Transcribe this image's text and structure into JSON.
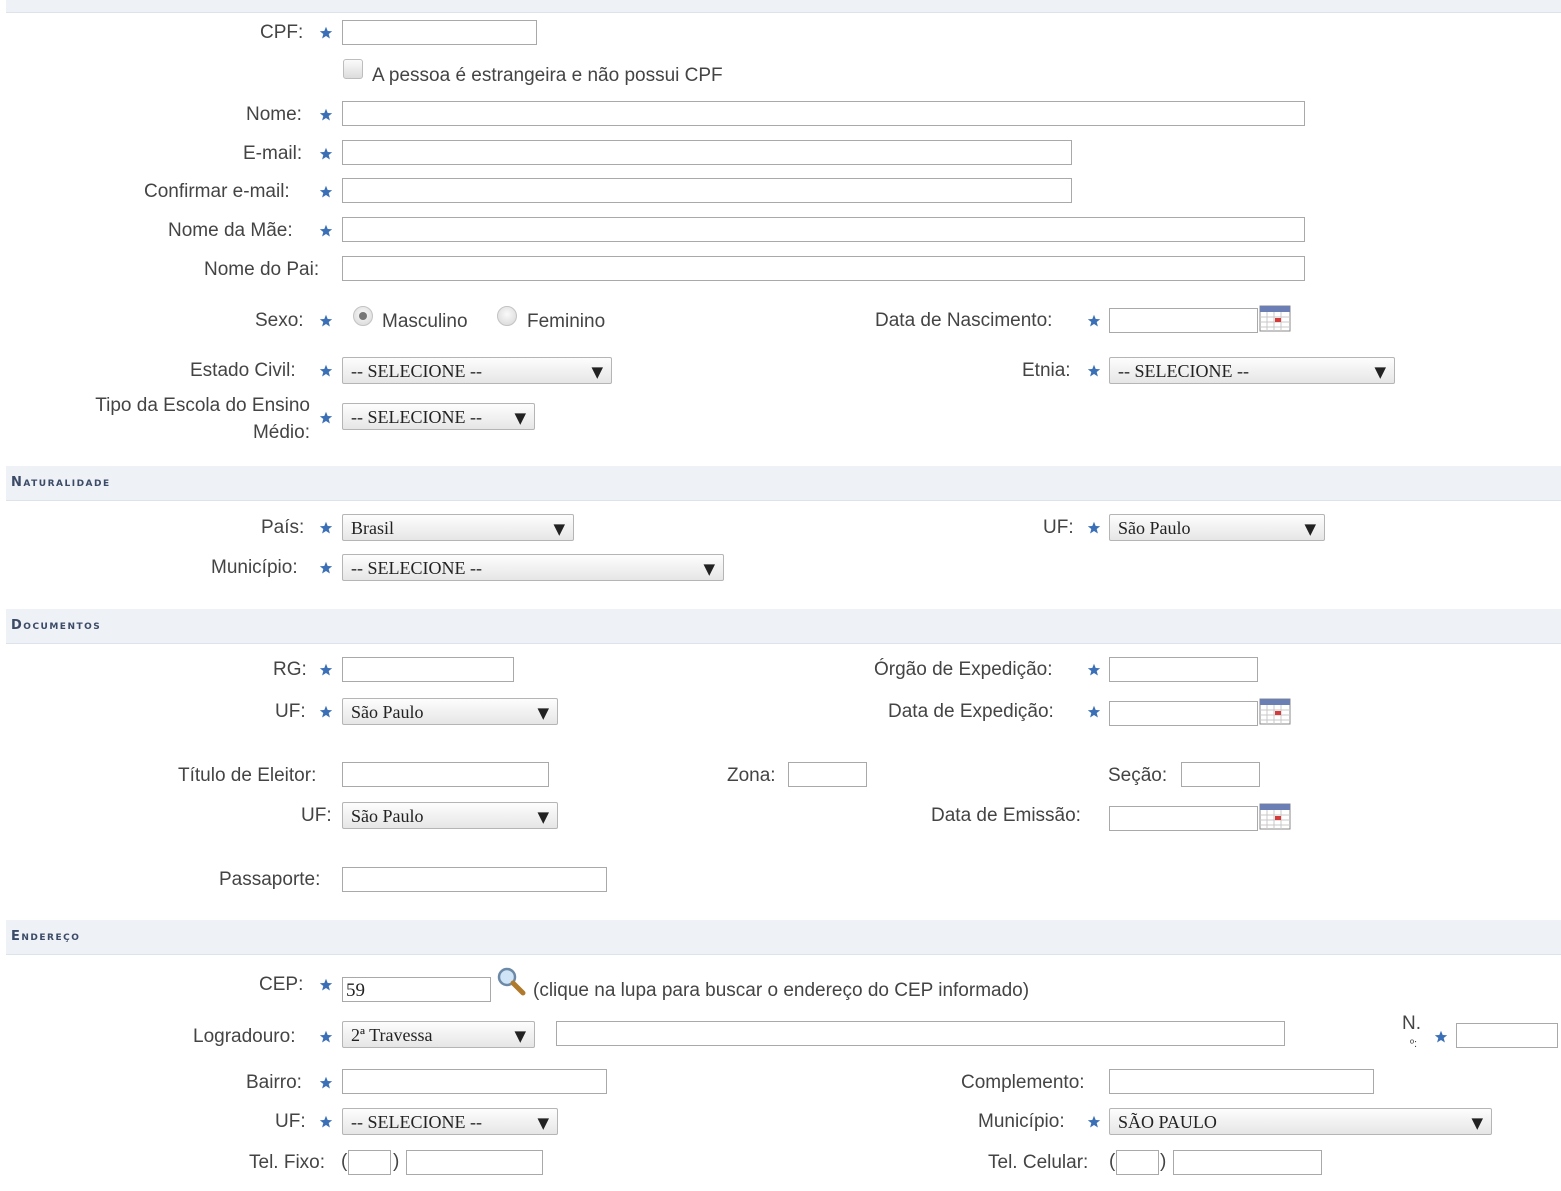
{
  "pessoais": {
    "cpf_label": "CPF:",
    "estrangeiro_label": "A pessoa é estrangeira e não possui CPF",
    "nome_label": "Nome:",
    "email_label": "E-mail:",
    "confirmar_email_label": "Confirmar e-mail:",
    "nome_mae_label": "Nome da Mãe:",
    "nome_pai_label": "Nome do Pai:",
    "sexo_label": "Sexo:",
    "sexo_masculino": "Masculino",
    "sexo_feminino": "Feminino",
    "sexo_selected": "Masculino",
    "data_nascimento_label": "Data de Nascimento:",
    "estado_civil_label": "Estado Civil:",
    "estado_civil_value": "-- SELECIONE --",
    "etnia_label": "Etnia:",
    "etnia_value": "-- SELECIONE --",
    "tipo_escola_label_1": "Tipo da Escola do Ensino",
    "tipo_escola_label_2": "Médio:",
    "tipo_escola_value": "-- SELECIONE --"
  },
  "naturalidade": {
    "title": "Naturalidade",
    "pais_label": "País:",
    "pais_value": "Brasil",
    "uf_label": "UF:",
    "uf_value": "São Paulo",
    "municipio_label": "Município:",
    "municipio_value": "-- SELECIONE --"
  },
  "documentos": {
    "title": "Documentos",
    "rg_label": "RG:",
    "orgao_label": "Órgão de Expedição:",
    "uf_label": "UF:",
    "uf_value": "São Paulo",
    "data_expedicao_label": "Data de Expedição:",
    "titulo_label": "Título de Eleitor:",
    "zona_label": "Zona:",
    "secao_label": "Seção:",
    "titulo_uf_label": "UF:",
    "titulo_uf_value": "São Paulo",
    "data_emissao_label": "Data de Emissão:",
    "passaporte_label": "Passaporte:"
  },
  "endereco": {
    "title": "Endereço",
    "cep_label": "CEP:",
    "cep_value": "59",
    "cep_hint": "(clique na lupa para buscar o endereço do CEP informado)",
    "logradouro_label": "Logradouro:",
    "logradouro_tipo_value": "2ª Travessa",
    "numero_label_1": "N.",
    "numero_label_2": "º:",
    "bairro_label": "Bairro:",
    "complemento_label": "Complemento:",
    "uf_label": "UF:",
    "uf_value": "-- SELECIONE --",
    "municipio_label": "Município:",
    "municipio_value": "SÃO PAULO",
    "tel_fixo_label": "Tel. Fixo:",
    "tel_celular_label": "Tel. Celular:"
  },
  "colors": {
    "section_bg": "#eef1f6",
    "section_text": "#3b4a66",
    "required_star": "#3b6fb6"
  },
  "icons": [
    "required-star-icon",
    "calendar-icon",
    "magnifier-icon",
    "dropdown-arrow-icon"
  ]
}
